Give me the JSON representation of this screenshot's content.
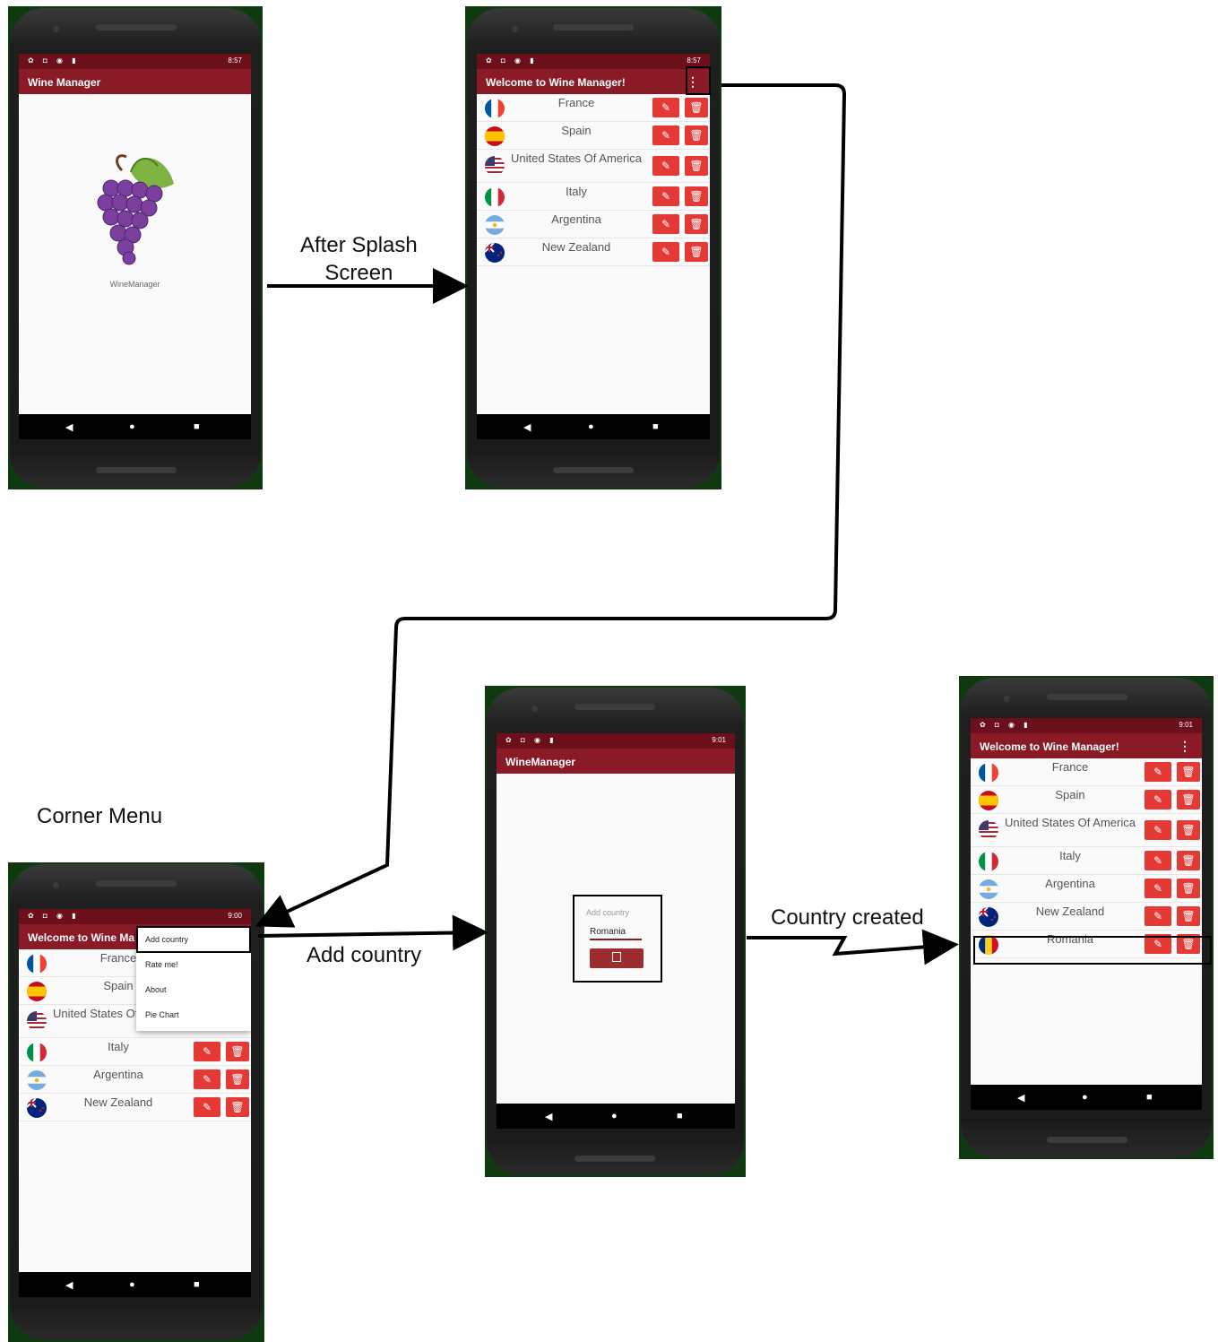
{
  "labels": {
    "after_splash": "After Splash\nScreen",
    "corner_menu": "Corner Menu",
    "add_country": "Add country",
    "country_created": "Country created"
  },
  "splash": {
    "time": "8:57",
    "title": "Wine Manager",
    "logo_caption": "WineManager"
  },
  "list_screen": {
    "time": "8:57",
    "title": "Welcome to Wine Manager!",
    "countries": [
      "France",
      "Spain",
      "United States Of America",
      "Italy",
      "Argentina",
      "New Zealand"
    ]
  },
  "menu_screen": {
    "time": "9:00",
    "title": "Welcome to Wine Ma",
    "countries": [
      "France",
      "Spain",
      "United States Of America",
      "Italy",
      "Argentina",
      "New Zealand"
    ],
    "menu_items": [
      "Add country",
      "Rate me!",
      "About",
      "Pie Chart"
    ]
  },
  "add_screen": {
    "time": "9:01",
    "title": "WineManager",
    "field_label": "Add country",
    "field_value": "Romania"
  },
  "final_screen": {
    "time": "9:01",
    "title": "Welcome to Wine Manager!",
    "countries": [
      "France",
      "Spain",
      "United States Of America",
      "Italy",
      "Argentina",
      "New Zealand",
      "Romania"
    ]
  },
  "colors": {
    "appbar": "#8b1a27",
    "statusbar": "#6b0f1b",
    "action_button": "#e53935"
  },
  "icons": {
    "edit": "pencil-icon",
    "delete": "trash-icon",
    "save": "save-icon",
    "overflow": "more-vert-icon"
  }
}
